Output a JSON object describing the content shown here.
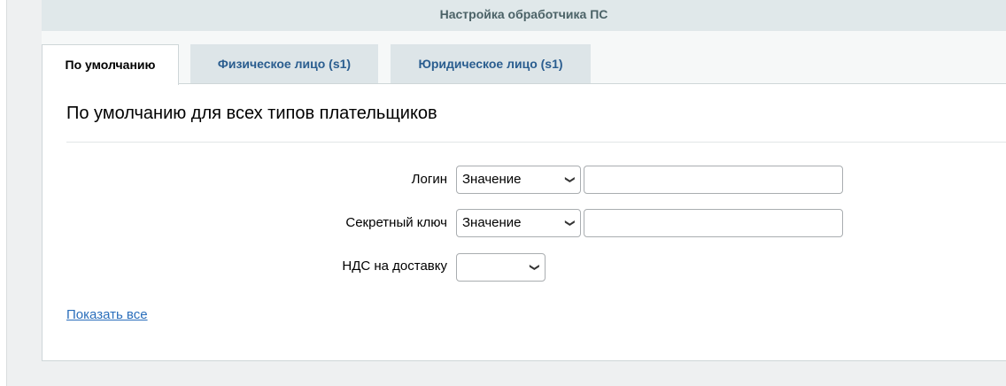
{
  "header": {
    "title": "Настройка обработчика ПС"
  },
  "tabs": [
    {
      "label": "По умолчанию",
      "active": true
    },
    {
      "label": "Физическое лицо (s1)",
      "active": false
    },
    {
      "label": "Юридическое лицо (s1)",
      "active": false
    }
  ],
  "section": {
    "title": "По умолчанию для всех типов плательщиков"
  },
  "fields": {
    "login": {
      "label": "Логин",
      "type_value": "Значение",
      "value": ""
    },
    "secret": {
      "label": "Секретный ключ",
      "type_value": "Значение",
      "value": ""
    },
    "vat": {
      "label": "НДС на доставку",
      "value": ""
    }
  },
  "show_all": "Показать все",
  "colors": {
    "link": "#2a6ebb",
    "tab_inactive_text": "#2a5d8f",
    "header_bg": "#e0e8ea"
  }
}
